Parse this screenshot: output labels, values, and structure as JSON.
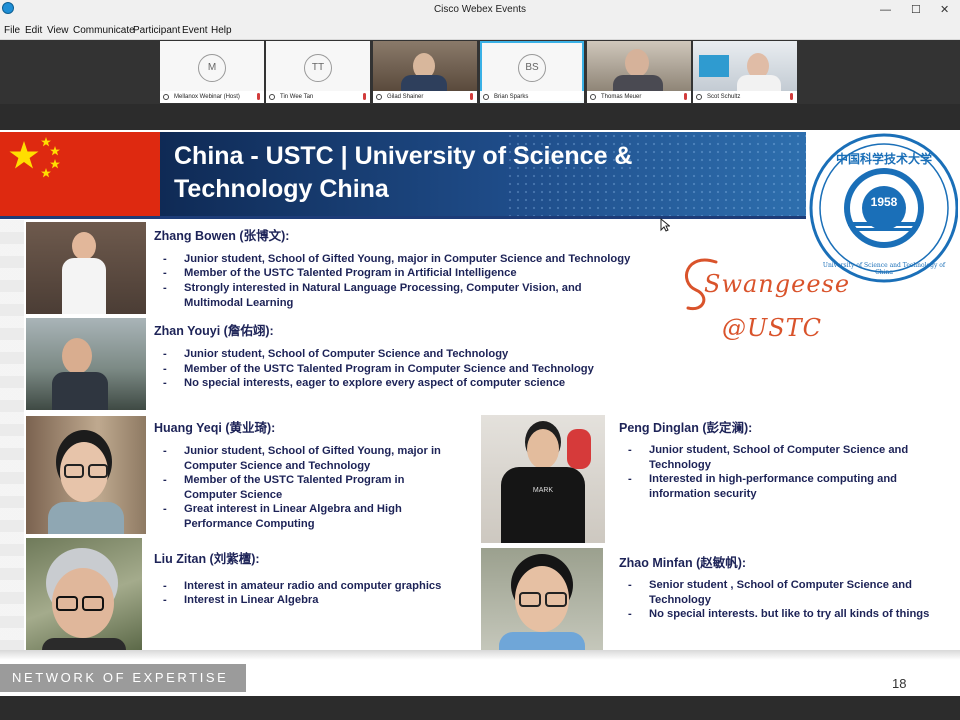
{
  "window": {
    "title": "Cisco Webex Events",
    "minimize": "—",
    "maximize": "☐",
    "close": "✕"
  },
  "menu": [
    "File",
    "Edit",
    "View",
    "Communicate",
    "Participant",
    "Event",
    "Help"
  ],
  "participants": [
    {
      "initials": "M",
      "name": "Mellanox Webinar (Host)"
    },
    {
      "initials": "TT",
      "name": "Tin Wee Tan"
    },
    {
      "initials": "",
      "name": "Gilad Shainer"
    },
    {
      "initials": "BS",
      "name": "Brian Sparks"
    },
    {
      "initials": "",
      "name": "Thomas Meuer"
    },
    {
      "initials": "",
      "name": "Scot Schultz"
    }
  ],
  "slide": {
    "title_line1": "China - USTC | University of Science &",
    "title_line2": "Technology China",
    "seal_year": "1958",
    "seal_cn": "中国科学技术大学",
    "seal_en": "University of Science and Technology of China",
    "logo_line1": "Swangeese",
    "logo_line2": "@USTC",
    "people": [
      {
        "name": "Zhang Bowen (张博文):",
        "bullets": [
          "Junior student, School of Gifted Young, major in Computer Science and Technology",
          "Member of the USTC Talented Program in Artificial Intelligence",
          "Strongly interested in Natural Language Processing, Computer Vision, and Multimodal Learning"
        ]
      },
      {
        "name": "Zhan Youyi (詹佑翊):",
        "bullets": [
          "Junior student, School of Computer Science and Technology",
          "Member of the USTC Talented Program in Computer Science and Technology",
          "No special interests, eager to explore every aspect of computer science"
        ]
      },
      {
        "name": "Huang Yeqi (黄业琦):",
        "bullets": [
          "Junior student, School of Gifted Young, major in Computer Science and Technology",
          "Member of the USTC Talented Program in Computer Science",
          "Great interest in Linear Algebra and High Performance Computing"
        ]
      },
      {
        "name": "Liu Zitan (刘紫檀):",
        "bullets": [
          "Interest in amateur radio and computer graphics",
          "Interest in Linear Algebra"
        ]
      },
      {
        "name": "Peng Dinglan (彭定澜):",
        "bullets": [
          "Junior student, School of Computer Science and Technology",
          "Interested in high-performance computing and information security"
        ]
      },
      {
        "name": "Zhao Minfan (赵敏帆):",
        "bullets": [
          "Senior student , School of Computer Science and Technology",
          "No special interests. but like to try all kinds of things"
        ]
      }
    ],
    "footer": "NETWORK OF EXPERTISE",
    "page_number": "18",
    "shirt_text": "MARK"
  }
}
